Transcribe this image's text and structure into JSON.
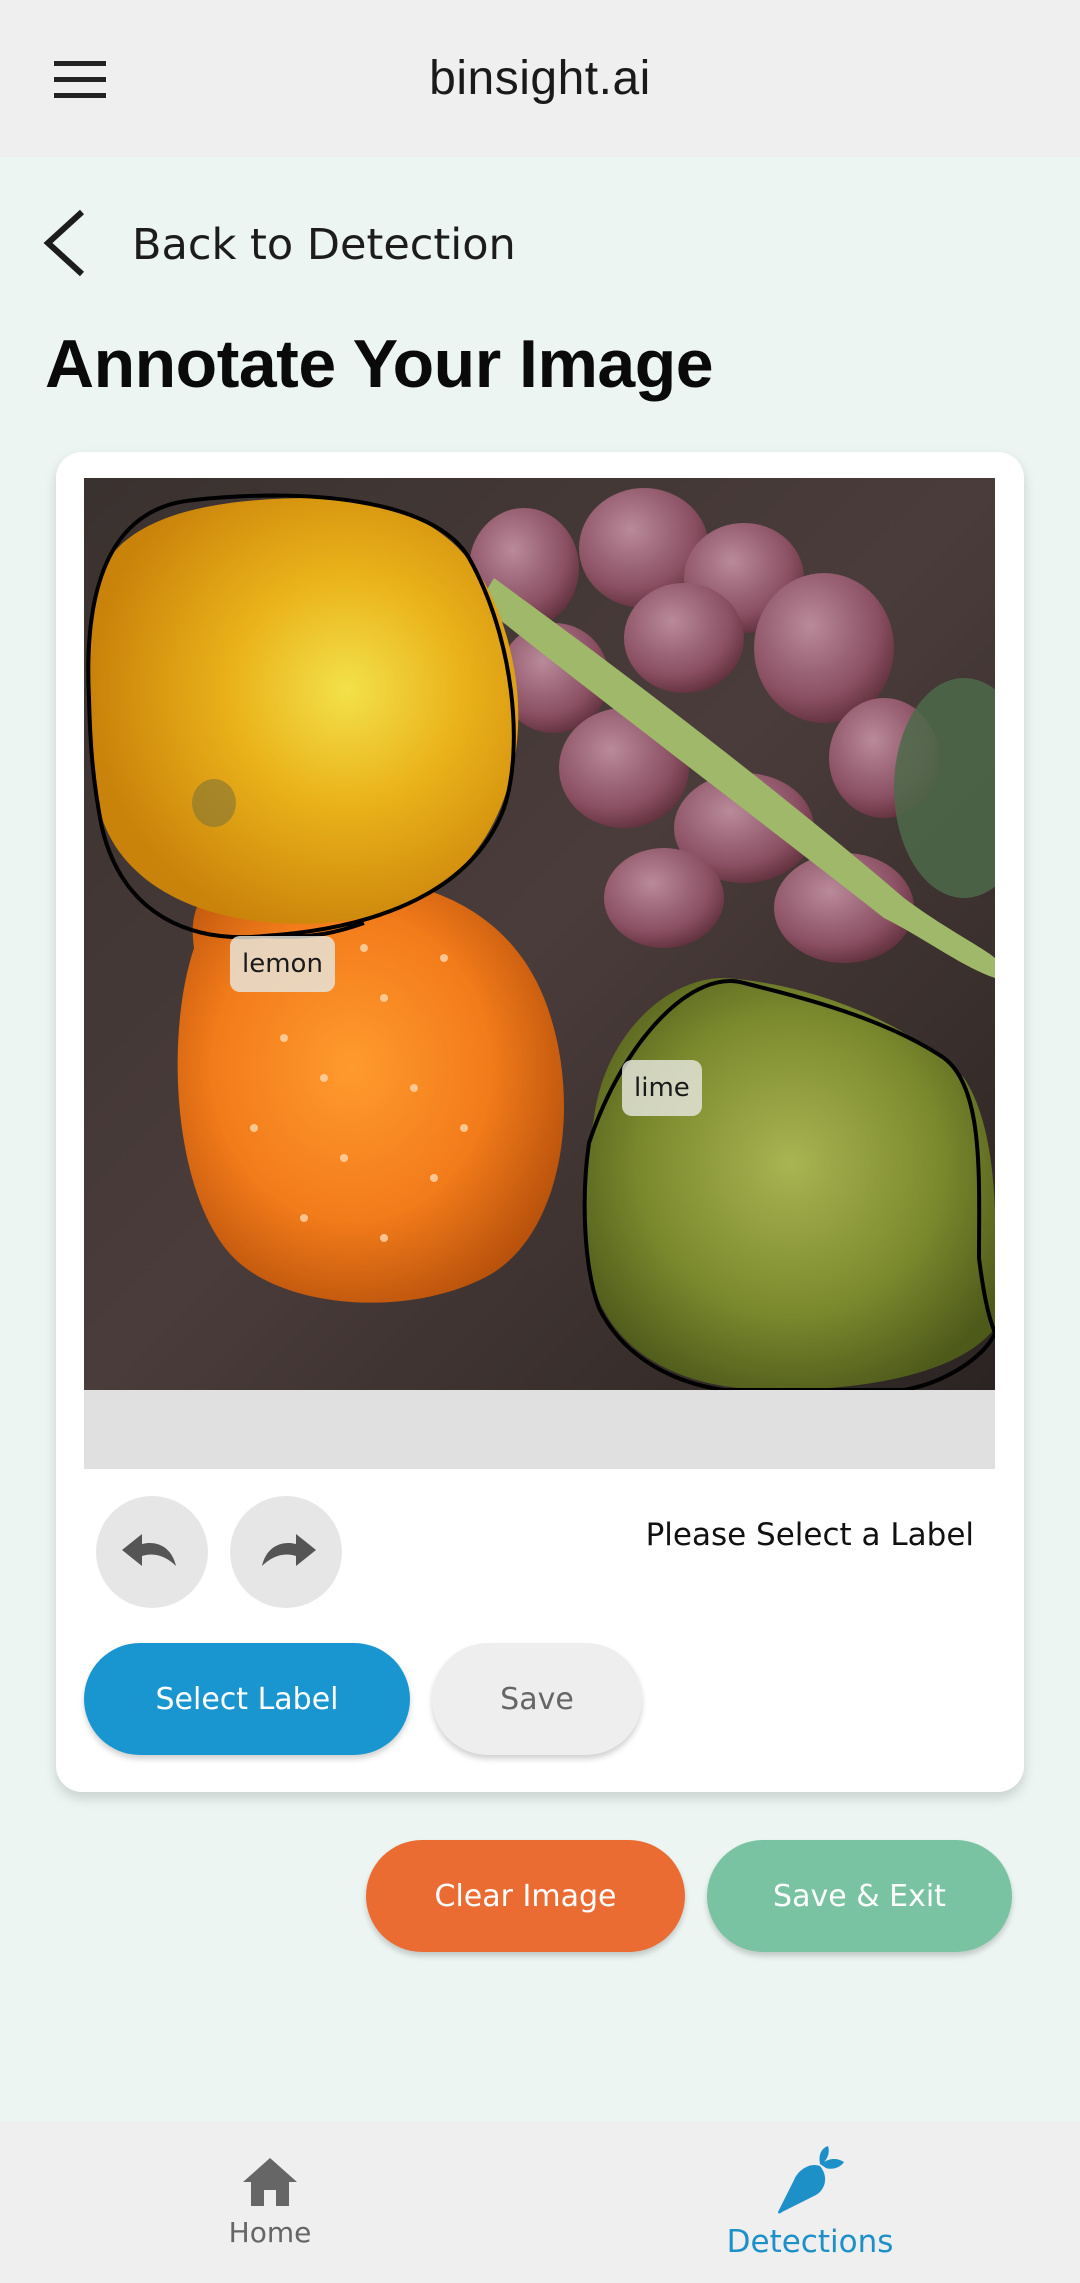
{
  "appbar": {
    "title": "binsight.ai",
    "menu_icon": "hamburger-menu-icon"
  },
  "back": {
    "label": "Back to Detection",
    "icon": "chevron-left-icon"
  },
  "page_title": "Annotate Your Image",
  "annotation": {
    "image_description_tag": "photo-fruits",
    "labels": [
      {
        "text": "lemon"
      },
      {
        "text": "lime"
      }
    ]
  },
  "controls": {
    "undo_icon": "undo-icon",
    "redo_icon": "redo-icon",
    "hint": "Please Select a Label",
    "select_label": "Select Label",
    "save": "Save"
  },
  "actions": {
    "clear_image": "Clear Image",
    "save_exit": "Save & Exit"
  },
  "nav": {
    "items": [
      {
        "label": "Home",
        "icon": "home-icon",
        "active": false
      },
      {
        "label": "Detections",
        "icon": "carrot-icon",
        "active": true
      }
    ],
    "active_color": "#1e90c8",
    "inactive_color": "#666666"
  },
  "colors": {
    "background": "#ecf5f2",
    "primary": "#1995cf",
    "orange": "#eb6c33",
    "green": "#79c3a2"
  }
}
